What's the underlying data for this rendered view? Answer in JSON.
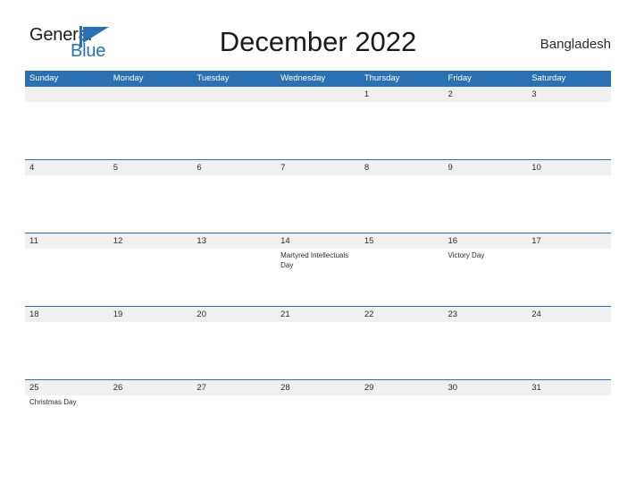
{
  "brand": {
    "name_part1": "General",
    "name_part2": "Blue",
    "flag_icon": "blue-triangle-flag-icon",
    "accent_color": "#2a71b4"
  },
  "header": {
    "title": "December 2022",
    "country": "Bangladesh"
  },
  "calendar": {
    "header_bg": "#2a71b4",
    "stripe_bg": "#f0f0f0",
    "weekdays": [
      "Sunday",
      "Monday",
      "Tuesday",
      "Wednesday",
      "Thursday",
      "Friday",
      "Saturday"
    ],
    "weeks": [
      [
        {
          "num": "",
          "event": ""
        },
        {
          "num": "",
          "event": ""
        },
        {
          "num": "",
          "event": ""
        },
        {
          "num": "",
          "event": ""
        },
        {
          "num": "1",
          "event": ""
        },
        {
          "num": "2",
          "event": ""
        },
        {
          "num": "3",
          "event": ""
        }
      ],
      [
        {
          "num": "4",
          "event": ""
        },
        {
          "num": "5",
          "event": ""
        },
        {
          "num": "6",
          "event": ""
        },
        {
          "num": "7",
          "event": ""
        },
        {
          "num": "8",
          "event": ""
        },
        {
          "num": "9",
          "event": ""
        },
        {
          "num": "10",
          "event": ""
        }
      ],
      [
        {
          "num": "11",
          "event": ""
        },
        {
          "num": "12",
          "event": ""
        },
        {
          "num": "13",
          "event": ""
        },
        {
          "num": "14",
          "event": "Martyred Intellectuals Day"
        },
        {
          "num": "15",
          "event": ""
        },
        {
          "num": "16",
          "event": "Victory Day"
        },
        {
          "num": "17",
          "event": ""
        }
      ],
      [
        {
          "num": "18",
          "event": ""
        },
        {
          "num": "19",
          "event": ""
        },
        {
          "num": "20",
          "event": ""
        },
        {
          "num": "21",
          "event": ""
        },
        {
          "num": "22",
          "event": ""
        },
        {
          "num": "23",
          "event": ""
        },
        {
          "num": "24",
          "event": ""
        }
      ],
      [
        {
          "num": "25",
          "event": "Christmas Day"
        },
        {
          "num": "26",
          "event": ""
        },
        {
          "num": "27",
          "event": ""
        },
        {
          "num": "28",
          "event": ""
        },
        {
          "num": "29",
          "event": ""
        },
        {
          "num": "30",
          "event": ""
        },
        {
          "num": "31",
          "event": ""
        }
      ]
    ]
  }
}
